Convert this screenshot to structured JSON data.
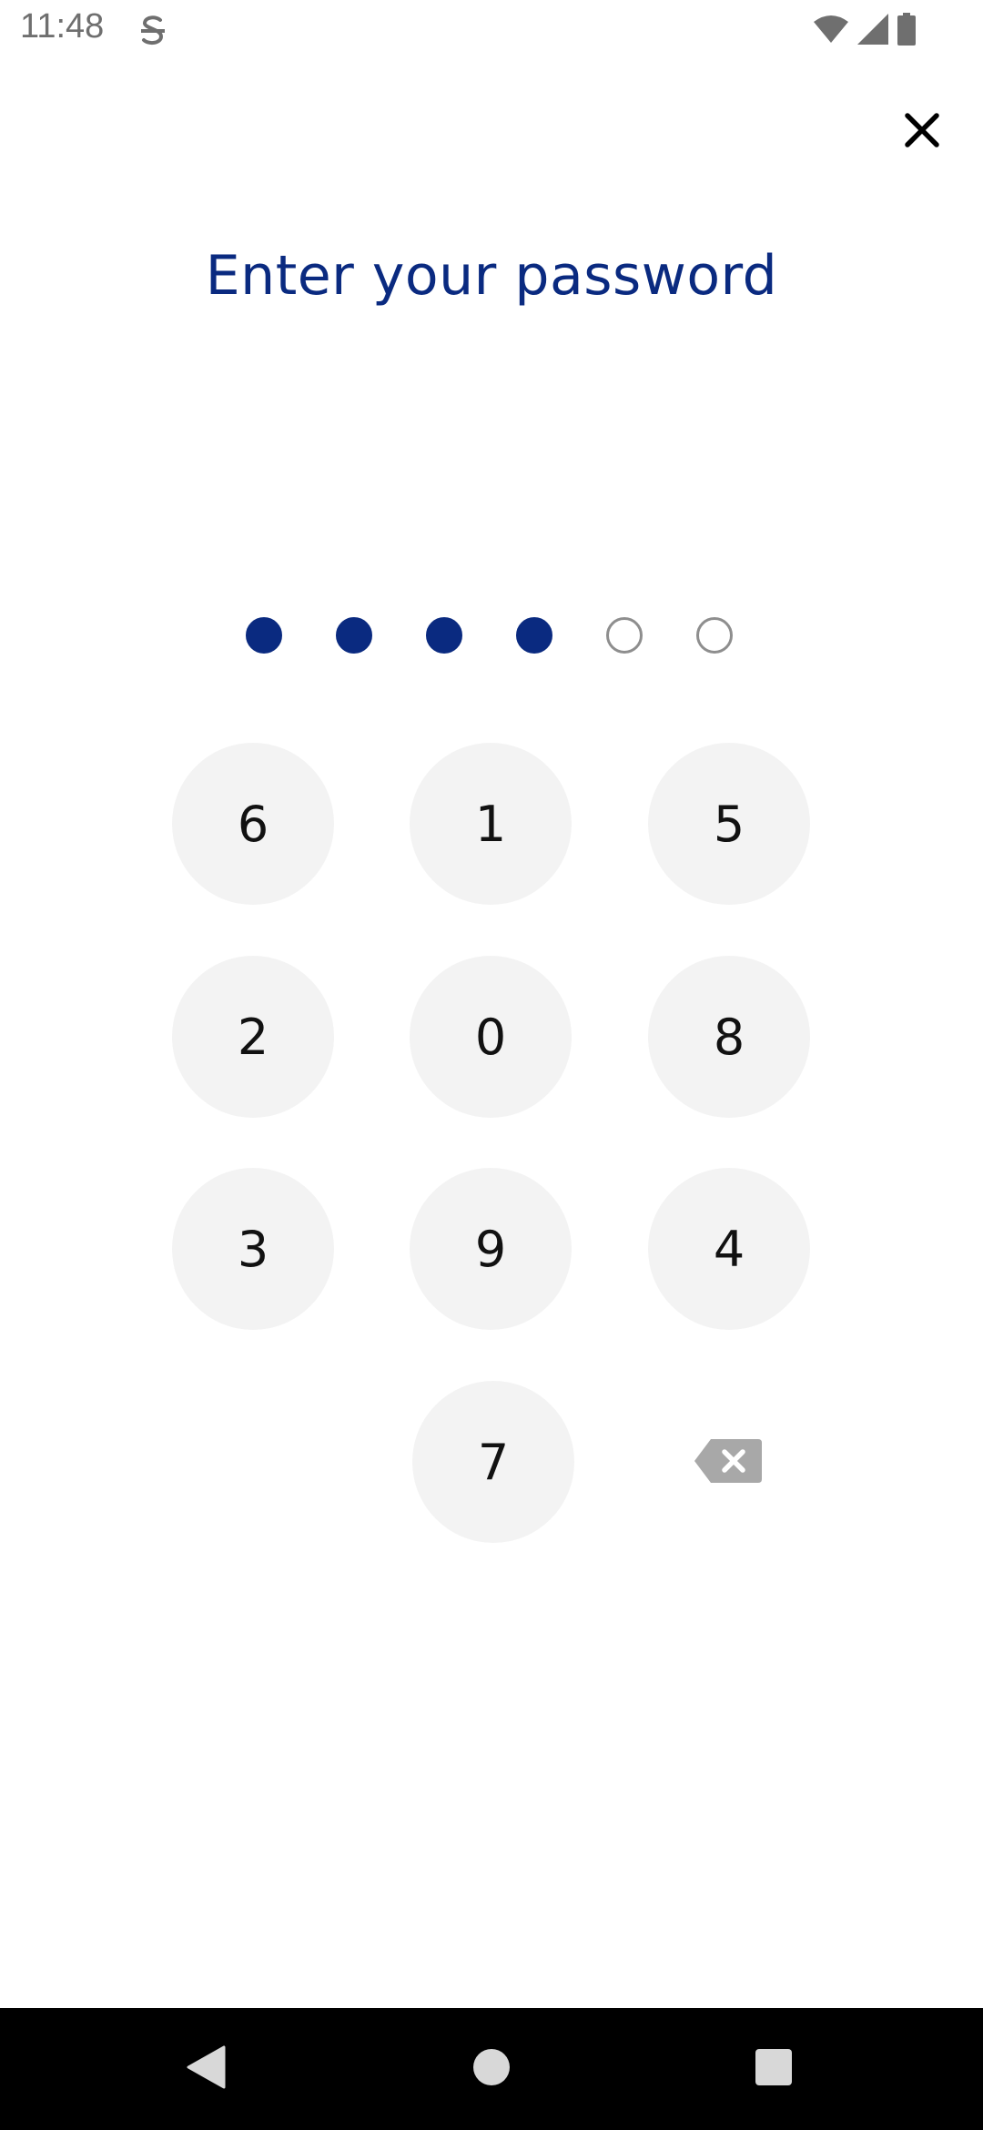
{
  "status_bar": {
    "time": "11:48",
    "app_icon": "s-logo-icon",
    "icons": [
      "wifi-icon",
      "cell-signal-icon",
      "battery-icon"
    ]
  },
  "header": {
    "close_icon": "close-icon"
  },
  "title": "Enter your password",
  "pin": {
    "length": 6,
    "filled": 4
  },
  "keypad": {
    "keys": [
      "6",
      "1",
      "5",
      "2",
      "0",
      "8",
      "3",
      "9",
      "4",
      "7"
    ],
    "backspace_icon": "backspace-icon"
  },
  "nav_bar": {
    "buttons": [
      "back-icon",
      "home-icon",
      "recents-icon"
    ]
  },
  "colors": {
    "accent": "#0a2a80",
    "key_background": "#f3f3f3",
    "key_text": "#111111",
    "empty_dot_border": "#8e8e8e",
    "backspace": "#a8a8a8"
  }
}
